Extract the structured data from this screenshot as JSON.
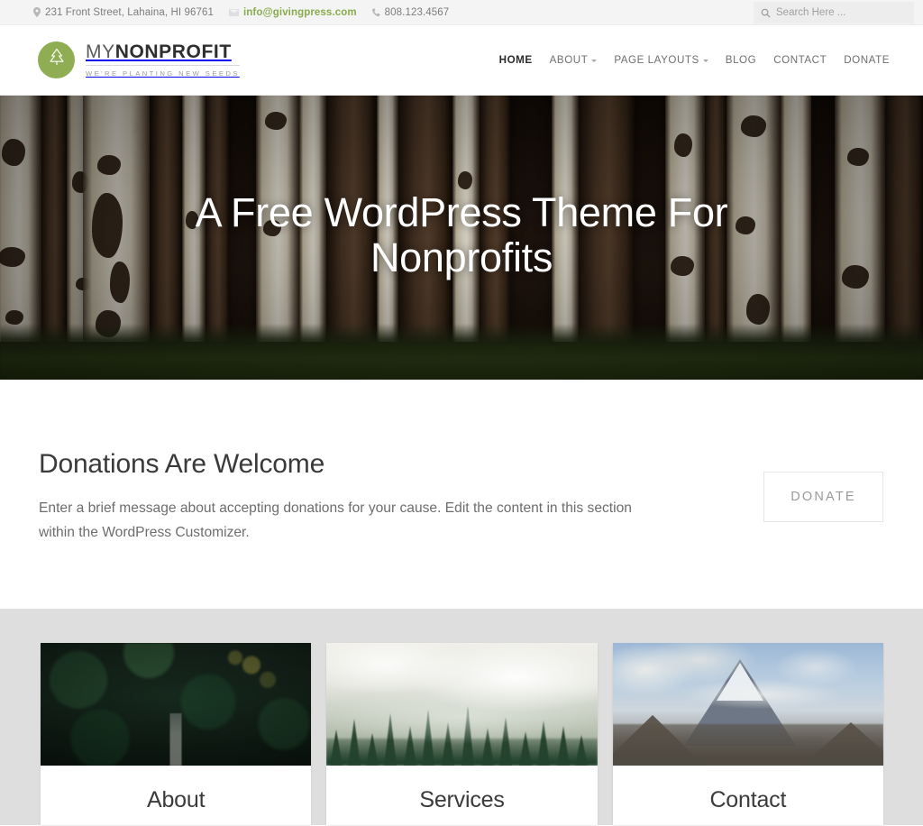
{
  "topbar": {
    "address": "231 Front Street, Lahaina, HI 96761",
    "email": "info@givingpress.com",
    "phone": "808.123.4567",
    "search_placeholder": "Search Here ...",
    "search_value": "",
    "link_color": "#8aab4e"
  },
  "header": {
    "brand_thin": "MY",
    "brand_bold": "NONPROFIT",
    "tagline": "WE'RE PLANTING NEW SEEDS",
    "logo_color": "#8fae54",
    "nav": [
      {
        "label": "HOME",
        "active": true,
        "dropdown": false
      },
      {
        "label": "ABOUT",
        "active": false,
        "dropdown": true
      },
      {
        "label": "PAGE LAYOUTS",
        "active": false,
        "dropdown": true
      },
      {
        "label": "BLOG",
        "active": false,
        "dropdown": false
      },
      {
        "label": "CONTACT",
        "active": false,
        "dropdown": false
      },
      {
        "label": "DONATE",
        "active": false,
        "dropdown": false
      }
    ]
  },
  "hero": {
    "title": "A Free WordPress Theme For Nonprofits",
    "image_description": "birch-aspen-forest-photo"
  },
  "donations": {
    "title": "Donations Are Welcome",
    "body": "Enter a brief message about accepting donations for your cause. Edit the content in this section within the WordPress Customizer.",
    "button_label": "DONATE"
  },
  "cards": [
    {
      "title": "About",
      "image_description": "dark-forest-path-photo"
    },
    {
      "title": "Services",
      "image_description": "misty-pine-forest-photo"
    },
    {
      "title": "Contact",
      "image_description": "snowy-mountain-peak-photo"
    }
  ]
}
